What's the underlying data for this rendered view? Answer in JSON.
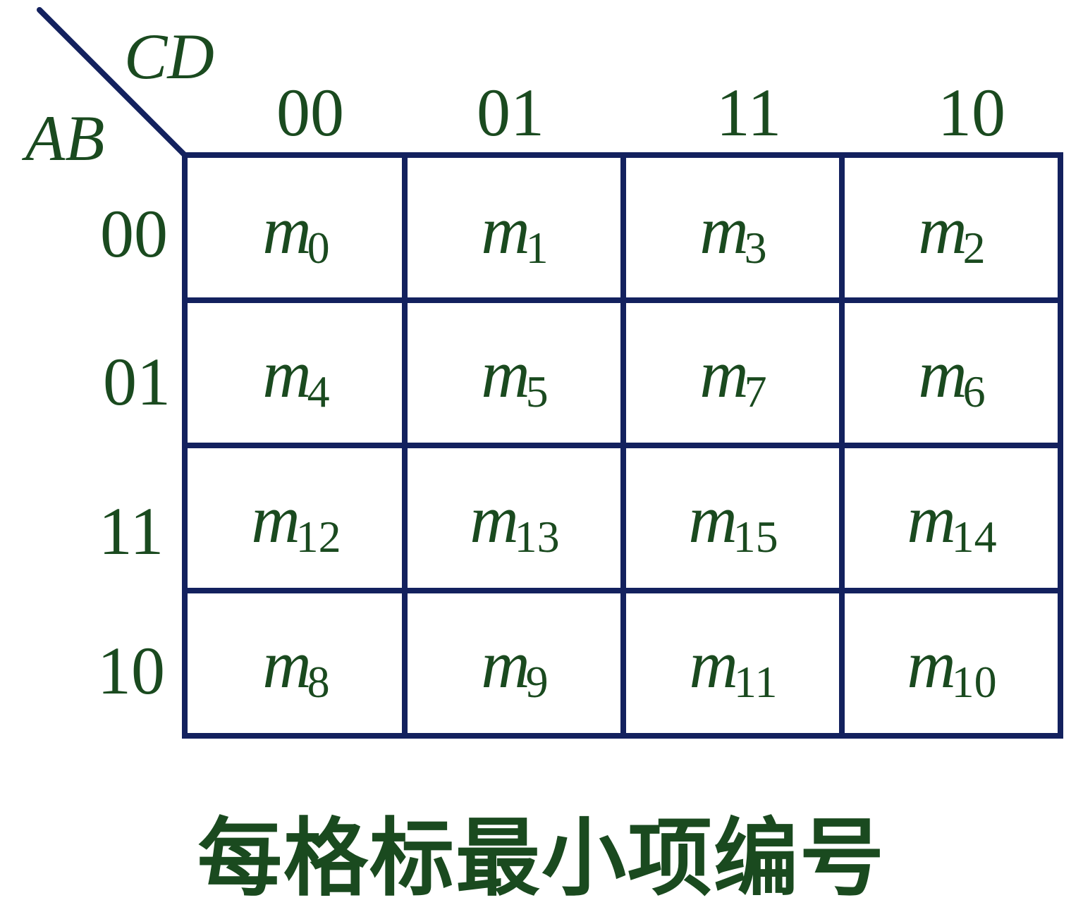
{
  "kmap": {
    "col_var": "CD",
    "row_var": "AB",
    "col_codes": [
      "00",
      "01",
      "11",
      "10"
    ],
    "row_codes": [
      "00",
      "01",
      "11",
      "10"
    ],
    "term_letter": "m",
    "cells": [
      [
        "0",
        "1",
        "3",
        "2"
      ],
      [
        "4",
        "5",
        "7",
        "6"
      ],
      [
        "12",
        "13",
        "15",
        "14"
      ],
      [
        "8",
        "9",
        "11",
        "10"
      ]
    ]
  },
  "caption": "每格标最小项编号",
  "colors": {
    "grid": "#13215e",
    "text": "#1a4a1f"
  }
}
